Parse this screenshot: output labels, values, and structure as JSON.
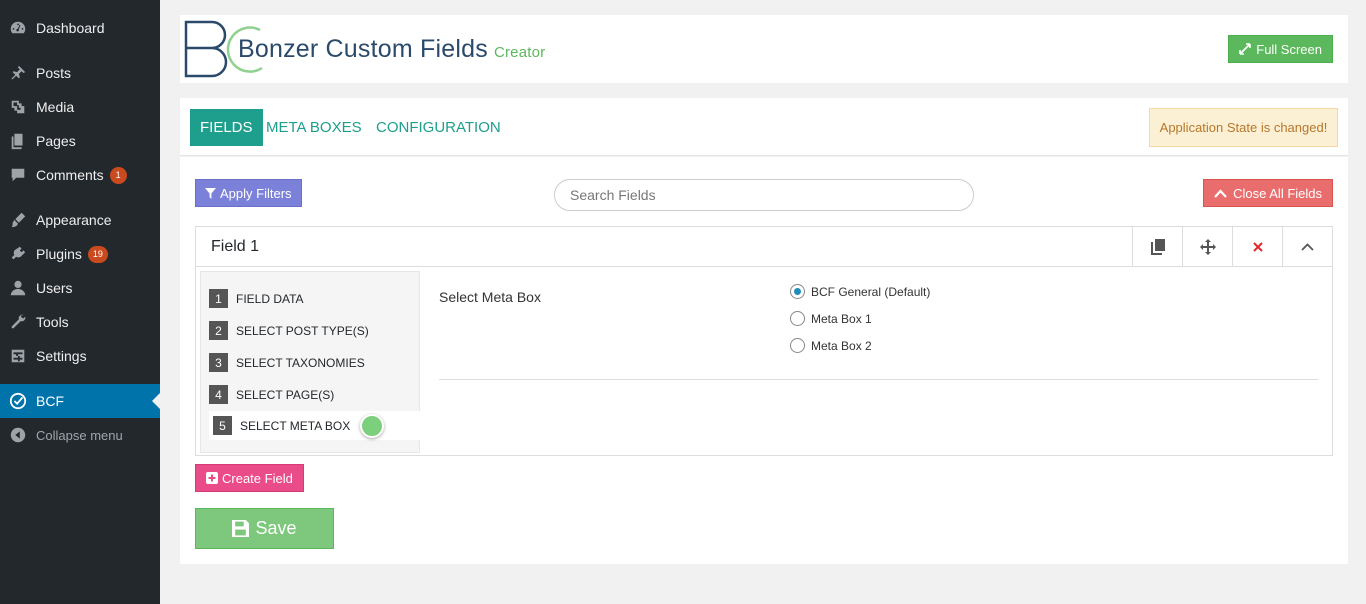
{
  "sidebar": {
    "items": [
      {
        "label": "Dashboard",
        "icon": "dashboard-icon"
      },
      {
        "label": "Posts",
        "icon": "pin-icon"
      },
      {
        "label": "Media",
        "icon": "media-icon"
      },
      {
        "label": "Pages",
        "icon": "pages-icon"
      },
      {
        "label": "Comments",
        "icon": "comment-icon",
        "badge": "1"
      },
      {
        "label": "Appearance",
        "icon": "brush-icon"
      },
      {
        "label": "Plugins",
        "icon": "plugin-icon",
        "badge": "19"
      },
      {
        "label": "Users",
        "icon": "user-icon"
      },
      {
        "label": "Tools",
        "icon": "wrench-icon"
      },
      {
        "label": "Settings",
        "icon": "settings-icon"
      },
      {
        "label": "BCF",
        "icon": "check-circle-icon"
      },
      {
        "label": "Collapse menu",
        "icon": "collapse-icon"
      }
    ]
  },
  "header": {
    "title": "Bonzer Custom Fields",
    "subtitle": "Creator",
    "fullscreen_label": "Full Screen"
  },
  "tabs": [
    {
      "label": "FIELDS"
    },
    {
      "label": "META BOXES"
    },
    {
      "label": "CONFIGURATION"
    }
  ],
  "alert": {
    "text": "Application State is changed!"
  },
  "toolbar": {
    "apply_filters_label": "Apply Filters",
    "search_placeholder": "Search Fields",
    "close_all_label": "Close All Fields"
  },
  "field": {
    "title": "Field 1",
    "steps": [
      {
        "num": "1",
        "label": "FIELD DATA"
      },
      {
        "num": "2",
        "label": "SELECT POST TYPE(S)"
      },
      {
        "num": "3",
        "label": "SELECT TAXONOMIES"
      },
      {
        "num": "4",
        "label": "SELECT PAGE(S)"
      },
      {
        "num": "5",
        "label": "SELECT META BOX"
      }
    ],
    "section_label": "Select Meta Box",
    "options": [
      {
        "label": "BCF General (Default)",
        "selected": true
      },
      {
        "label": "Meta Box 1",
        "selected": false
      },
      {
        "label": "Meta Box 2",
        "selected": false
      }
    ]
  },
  "actions": {
    "create_field_label": "Create Field",
    "save_label": "Save"
  },
  "colors": {
    "sidebar_bg": "#23282d",
    "active_menu": "#0073aa",
    "teal": "#1e9e8c",
    "green": "#5cb85c",
    "red": "#ea6d6d",
    "pink": "#ea4c89",
    "indigo": "#7b80d9"
  }
}
